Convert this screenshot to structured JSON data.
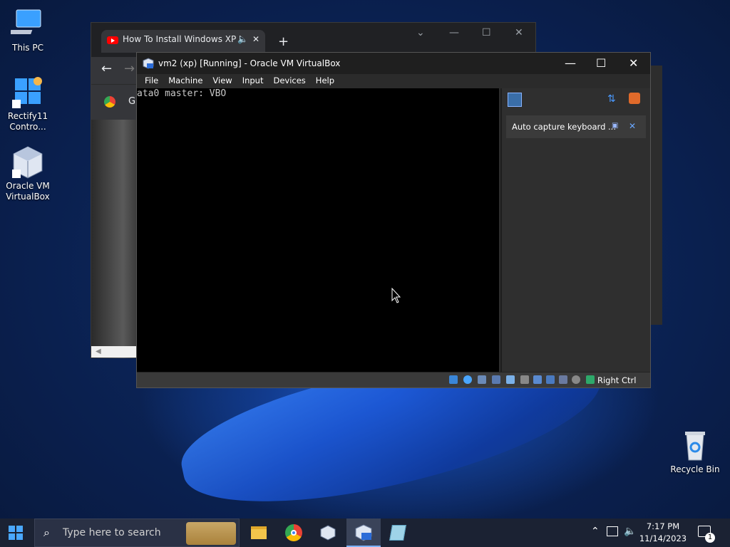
{
  "desktop": {
    "icons": [
      {
        "label": "This PC",
        "icon": "monitor-icon"
      },
      {
        "label": "Rectify11 Contro...",
        "icon": "control-panel-icon"
      },
      {
        "label": "Oracle VM VirtualBox",
        "icon": "virtualbox-icon"
      },
      {
        "label": "Recycle Bin",
        "icon": "recycle-bin-icon"
      }
    ]
  },
  "chrome": {
    "tab_title": "How To Install Windows XP I",
    "bookmark_label": "G"
  },
  "vbox": {
    "title": "vm2 (xp) [Running] - Oracle VM VirtualBox",
    "menu": [
      "File",
      "Machine",
      "View",
      "Input",
      "Devices",
      "Help"
    ],
    "screen_text": "ata0 master: VBO",
    "notice": "Auto capture keyboard ...",
    "host_key": "Right Ctrl"
  },
  "taskbar": {
    "search_placeholder": "Type here to search",
    "time": "7:17 PM",
    "date": "11/14/2023",
    "notification_count": "1"
  },
  "colors": {
    "accent": "#7fb3ff",
    "youtube": "#ff0000"
  }
}
